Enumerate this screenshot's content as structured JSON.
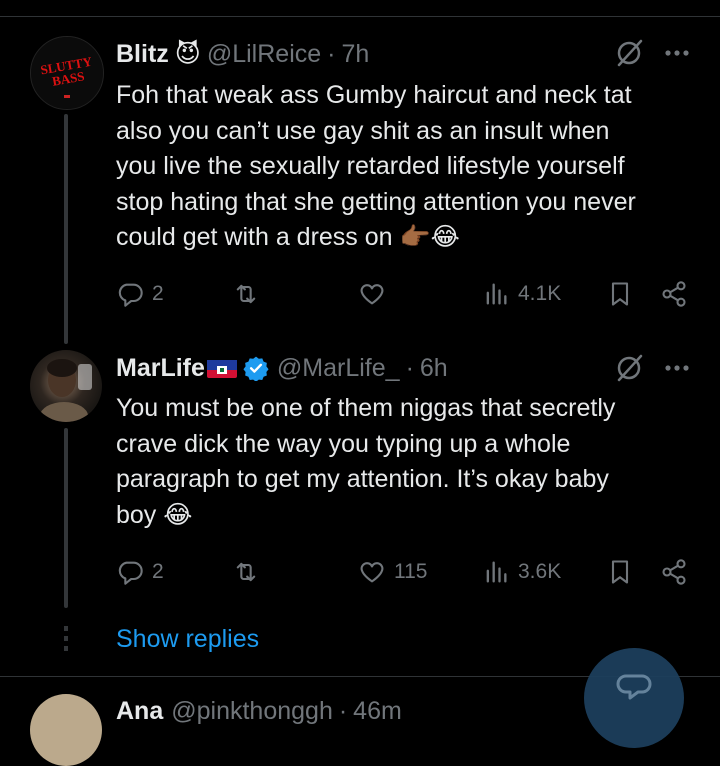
{
  "tweets": [
    {
      "name": "Blitz",
      "name_emoji": "😈",
      "handle": "@LilReice",
      "dot": "·",
      "time": "7h",
      "avatar_text": "SLUTTY BASS",
      "body_lines": [
        "Foh that weak ass Gumby  haircut and neck tat",
        "also you can’t use gay shit as an insult when",
        "you live the sexually retarded lifestyle yourself",
        "stop hating that she getting attention you never",
        "could get with a dress on 👉🏾😂"
      ],
      "replies": "2",
      "reposts": "",
      "likes": "",
      "views": "4.1K"
    },
    {
      "name": "MarLife",
      "handle": "@MarLife_",
      "dot": "·",
      "time": "6h",
      "body_lines": [
        "You must be one of them niggas that secretly",
        "crave dick the way you typing up a whole",
        "paragraph to get my attention. It’s okay baby",
        "boy 😂"
      ],
      "replies": "2",
      "reposts": "",
      "likes": "115",
      "views": "3.6K"
    }
  ],
  "show_replies": "Show replies",
  "next_tweet": {
    "name": "Ana",
    "handle": "@pinkthonggh",
    "dot": "·",
    "time": "46m"
  },
  "colors": {
    "background": "#000000",
    "text": "#e7e9ea",
    "muted": "#71767b",
    "accent": "#1d9bf0"
  },
  "icons": [
    "reply-icon",
    "repost-icon",
    "like-icon",
    "views-icon",
    "bookmark-icon",
    "share-icon",
    "grok-icon",
    "more-icon",
    "verified-badge-icon",
    "haiti-flag-icon",
    "compose-icon"
  ]
}
